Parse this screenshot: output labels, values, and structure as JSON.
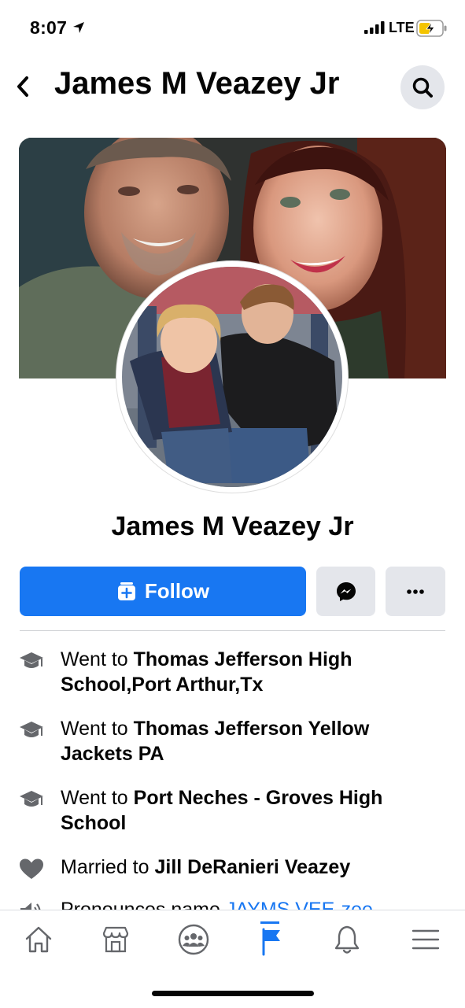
{
  "status_bar": {
    "time": "8:07",
    "network": "LTE"
  },
  "header": {
    "title": "James M Veazey Jr"
  },
  "profile": {
    "name": "James M Veazey Jr"
  },
  "actions": {
    "follow_label": "Follow"
  },
  "intro": {
    "items": [
      {
        "prefix": "Went to ",
        "value": "Thomas Jefferson High School,Port Arthur,Tx",
        "icon": "graduation-cap-icon"
      },
      {
        "prefix": "Went to ",
        "value": "Thomas Jefferson Yellow Jackets PA",
        "icon": "graduation-cap-icon"
      },
      {
        "prefix": "Went to ",
        "value": "Port Neches - Groves High School",
        "icon": "graduation-cap-icon"
      },
      {
        "prefix": "Married to ",
        "value": "Jill DeRanieri Veazey",
        "icon": "heart-icon"
      }
    ],
    "partial_item": {
      "prefix": "Pronounces name ",
      "value": "JAYMS VEE-zee",
      "icon": "speaker-icon"
    }
  },
  "bottom_nav": {
    "items": [
      "home-icon",
      "marketplace-icon",
      "groups-icon",
      "pages-flag-icon",
      "notifications-bell-icon",
      "menu-icon"
    ],
    "active": "pages-flag-icon"
  },
  "colors": {
    "accent": "#1877f2",
    "button_gray": "#e4e6eb",
    "text": "#050505"
  }
}
